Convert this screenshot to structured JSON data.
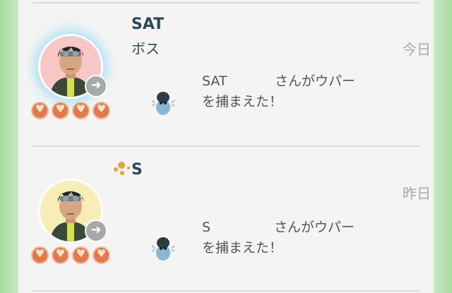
{
  "feed": [
    {
      "name": "SAT",
      "subtitle": "ボス",
      "date": "今日",
      "message_line1_prefix": "SAT",
      "message_line1_suffix": "さんがウパー",
      "message_line2": "を捕まえた！",
      "hearts": 4,
      "friend_icon": "arrow-right-icon",
      "pokemon_icon": "wooper-icon"
    },
    {
      "name": "S",
      "subtitle": "",
      "date": "昨日",
      "message_line1_prefix": "S",
      "message_line1_suffix": "さんがウパー",
      "message_line2": "を捕まえた！",
      "hearts": 4,
      "friend_icon": "arrow-right-icon",
      "pokemon_icon": "wooper-icon"
    }
  ],
  "colors": {
    "side_green": "#a9dca2",
    "name_text": "#2b4a58",
    "heart": "#e07a4c",
    "date_text": "#a5a8a7"
  }
}
